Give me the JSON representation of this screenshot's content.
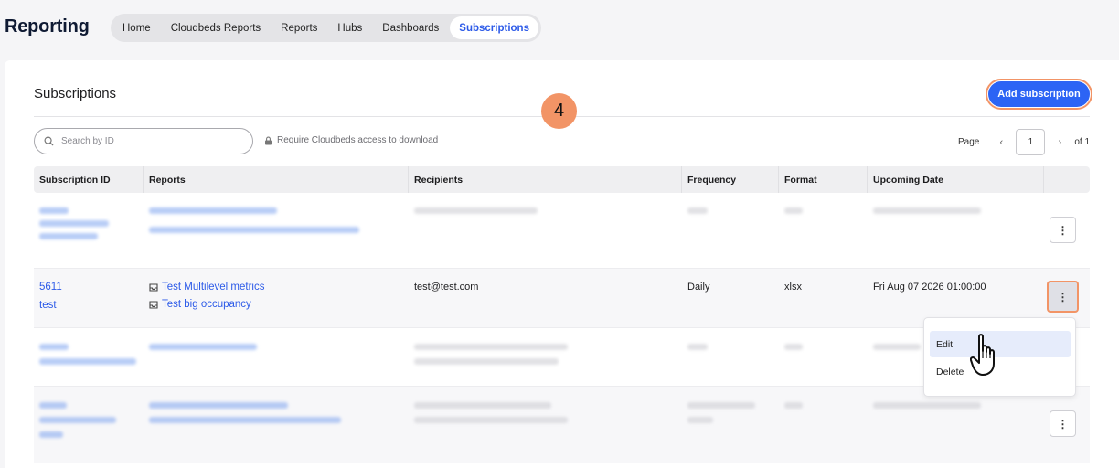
{
  "app": {
    "title": "Reporting"
  },
  "nav": {
    "tabs": [
      {
        "label": "Home"
      },
      {
        "label": "Cloudbeds Reports"
      },
      {
        "label": "Reports"
      },
      {
        "label": "Hubs"
      },
      {
        "label": "Dashboards"
      },
      {
        "label": "Subscriptions"
      }
    ],
    "active": "Subscriptions"
  },
  "page": {
    "title": "Subscriptions",
    "add_button": "Add subscription",
    "step_badge": "4"
  },
  "toolbar": {
    "search_placeholder": "Search by ID",
    "require_label": "Require Cloudbeds access to download"
  },
  "pagination": {
    "label": "Page",
    "current": "1",
    "of_label": "of 1"
  },
  "table": {
    "headers": [
      "Subscription ID",
      "Reports",
      "Recipients",
      "Frequency",
      "Format",
      "Upcoming Date"
    ],
    "visible_row": {
      "id": "5611",
      "name": "test",
      "reports": [
        "Test Multilevel metrics",
        "Test big occupancy"
      ],
      "recipients": "test@test.com",
      "frequency": "Daily",
      "format": "xlsx",
      "upcoming_date": "Fri Aug 07 2026 01:00:00"
    }
  },
  "row_menu": {
    "items": [
      "Edit",
      "Delete"
    ],
    "hovered": "Edit"
  },
  "colors": {
    "accent": "#2c64f5",
    "highlight": "#f29466",
    "link": "#2c5ae8"
  }
}
